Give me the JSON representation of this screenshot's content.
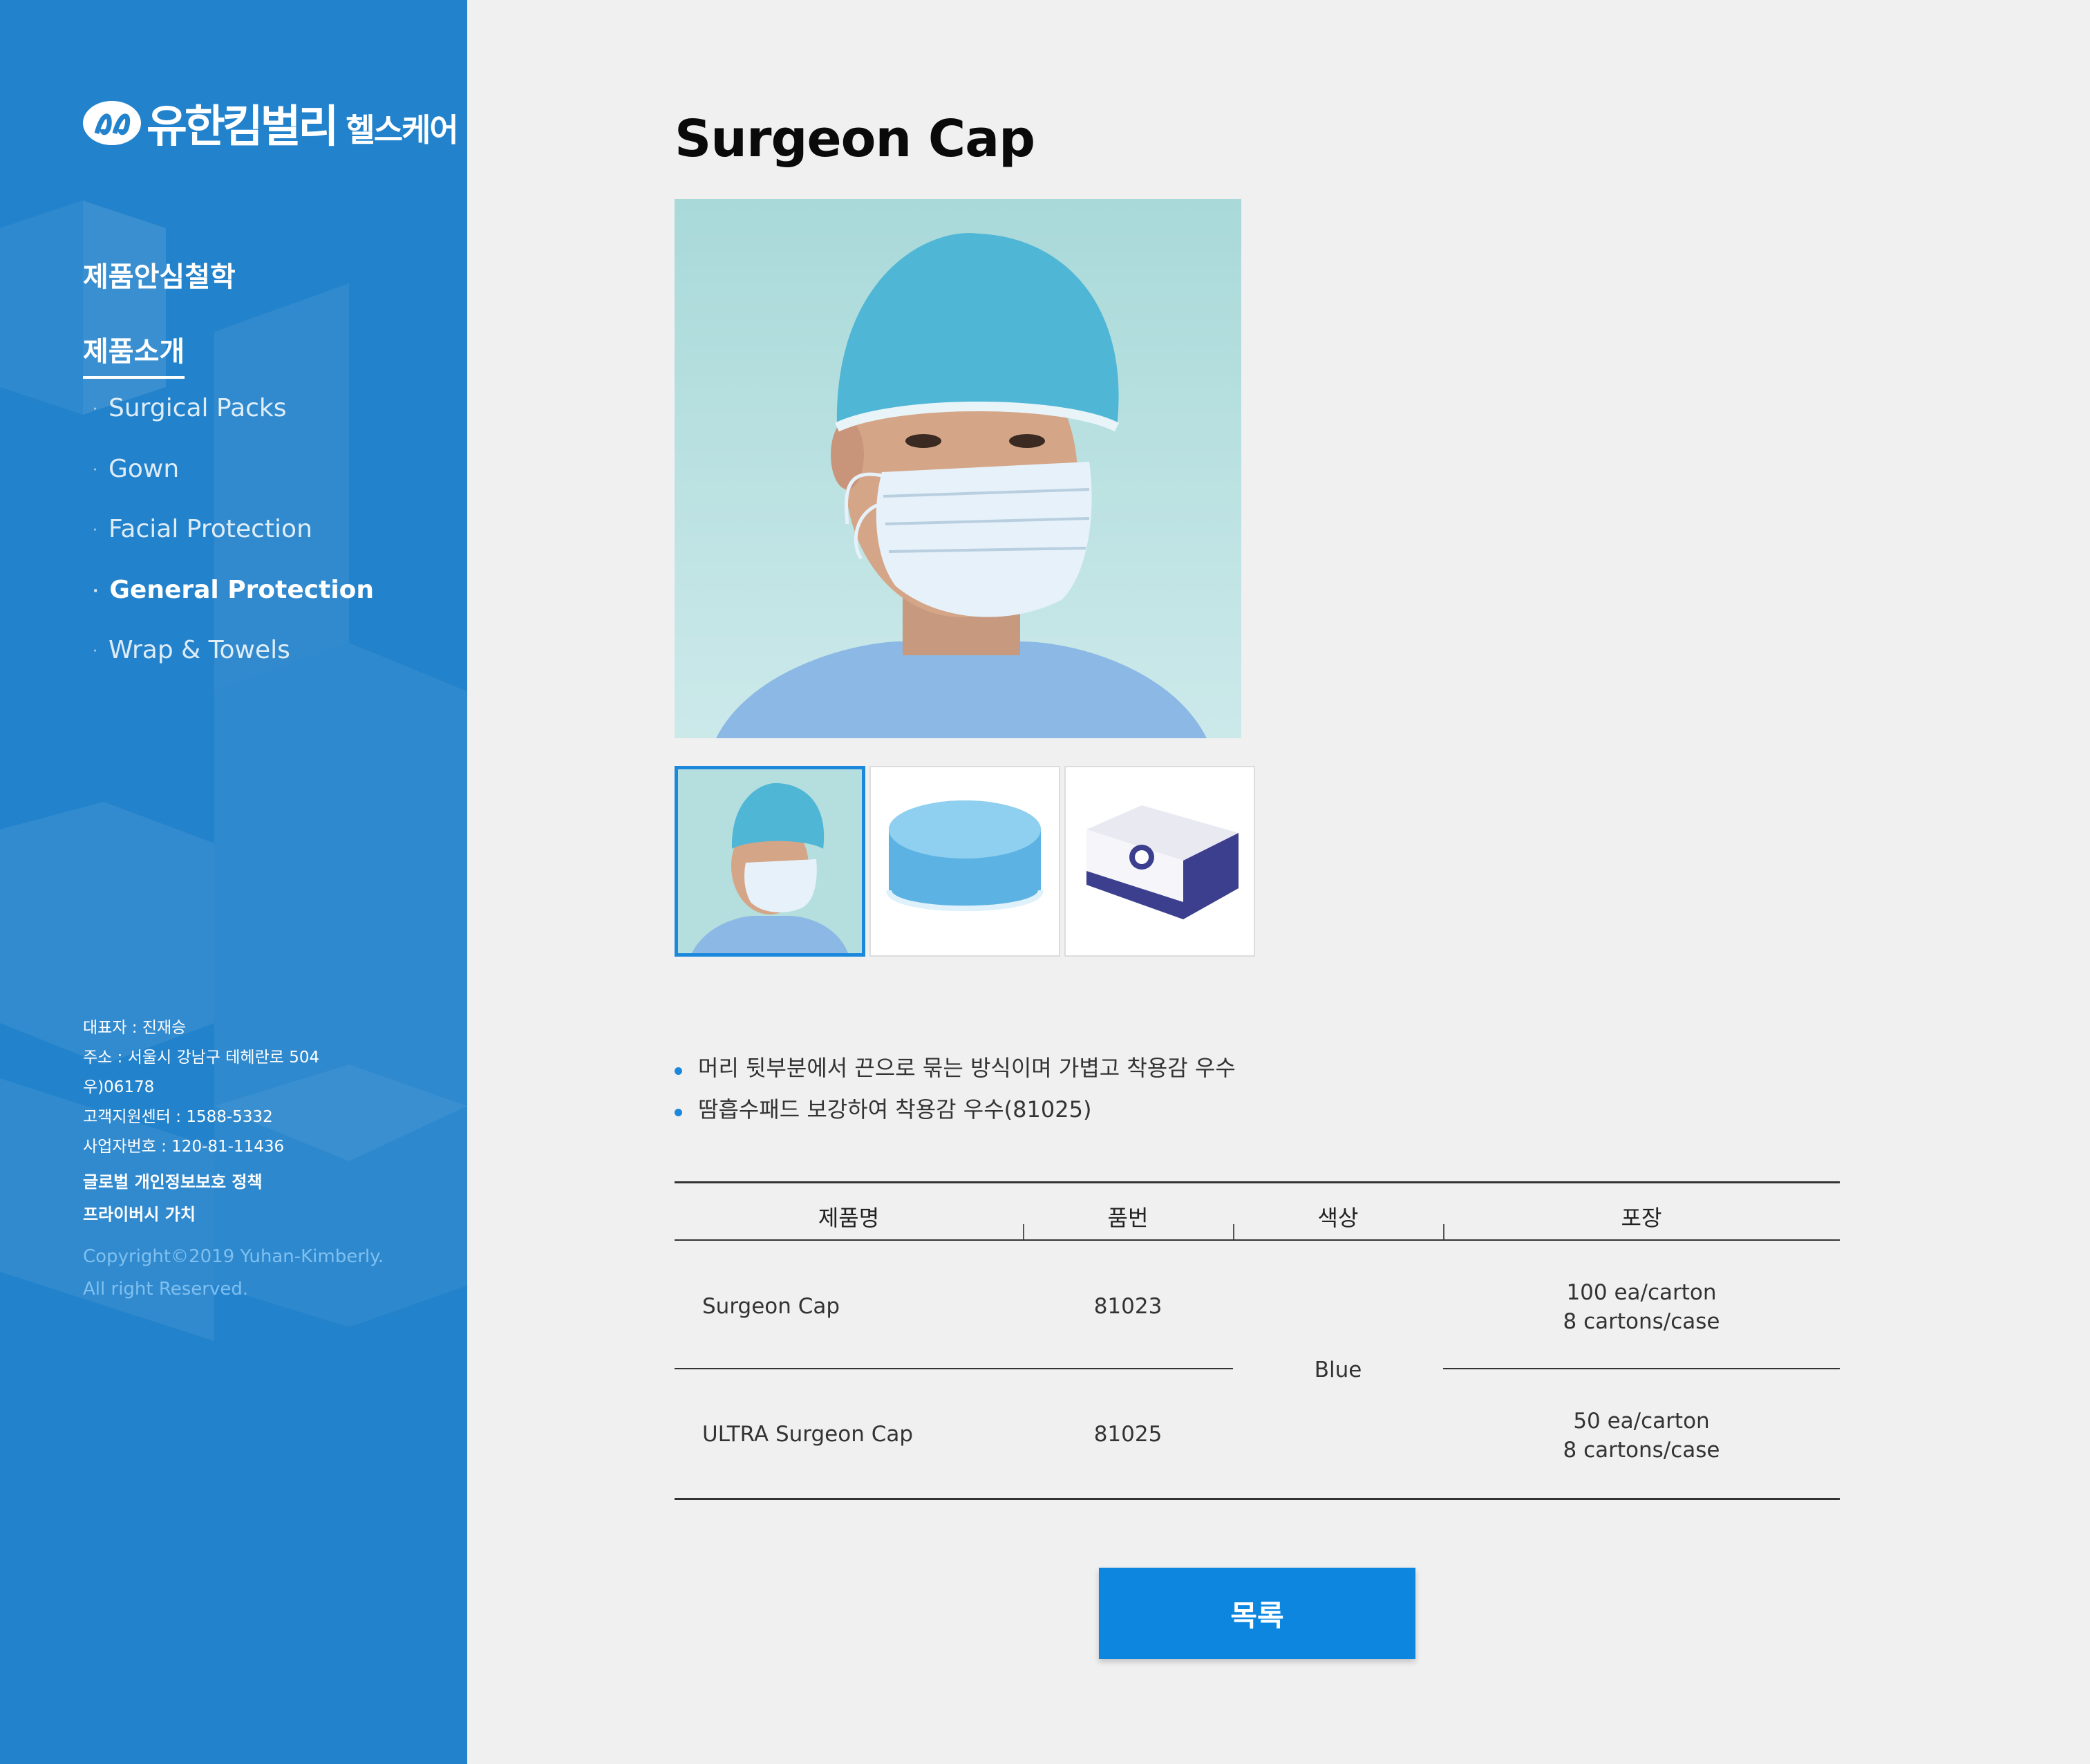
{
  "sidebar": {
    "logo": {
      "main": "유한킴벌리",
      "sub": "헬스케어"
    },
    "nav": {
      "philosophy": "제품안심철학",
      "products": "제품소개",
      "items": [
        {
          "label": "Surgical Packs"
        },
        {
          "label": "Gown"
        },
        {
          "label": "Facial Protection"
        },
        {
          "label": "General Protection"
        },
        {
          "label": "Wrap & Towels"
        }
      ]
    },
    "info": {
      "ceo": "대표자 : 진재승",
      "address": "주소 : 서울시 강남구 테헤란로 504",
      "zip": "우)06178",
      "support": "고객지원센터 : 1588-5332",
      "biz": "사업자번호 : 120-81-11436",
      "privacy": "글로벌 개인정보보호 정책",
      "privacy_value": "프라이버시 가치",
      "copyright": "Copyright©2019 Yuhan-Kimberly.",
      "rights": "All right Reserved."
    }
  },
  "product": {
    "title": "Surgeon Cap",
    "bullets": [
      "머리 뒷부분에서 끈으로 묶는 방식이며 가볍고 착용감 우수",
      "땀흡수패드 보강하여 착용감 우수(81025)"
    ]
  },
  "table": {
    "headers": {
      "name": "제품명",
      "code": "품번",
      "color": "색상",
      "pack": "포장"
    },
    "rows": [
      {
        "name": "Surgeon Cap",
        "code": "81023",
        "pack1": "100 ea/carton",
        "pack2": "8 cartons/case"
      },
      {
        "name": "ULTRA Surgeon Cap",
        "code": "81025",
        "pack1": "50 ea/carton",
        "pack2": "8 cartons/case"
      }
    ],
    "color": "Blue"
  },
  "button": {
    "list": "목록"
  },
  "colors": {
    "sidebar": "#2282cb",
    "accent": "#0d86e0",
    "background": "#f0f0f0"
  }
}
